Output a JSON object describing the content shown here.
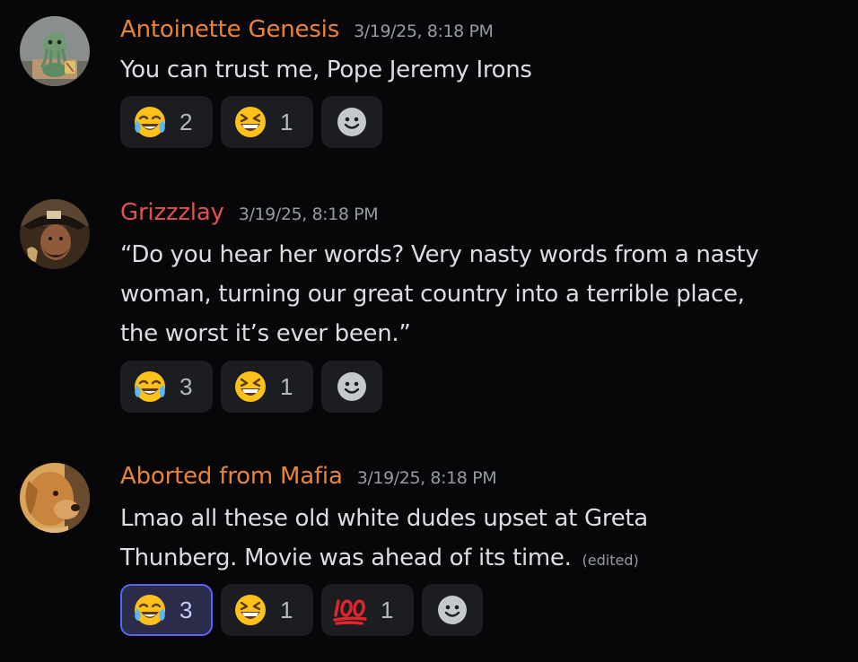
{
  "messages": [
    {
      "username": "Antoinette Genesis",
      "username_color": "#e8843a",
      "timestamp": "3/19/25, 8:18 PM",
      "avatar_icon": "cthulhu-avatar",
      "lines": [
        "You can trust me, Pope Jeremy Irons"
      ],
      "reactions": [
        {
          "emoji": "joy-emoji",
          "count": "2",
          "me": false
        },
        {
          "emoji": "laughing-emoji",
          "count": "1",
          "me": false
        }
      ]
    },
    {
      "username": "Grizzzlay",
      "username_color": "#e0504f",
      "timestamp": "3/19/25, 8:18 PM",
      "avatar_icon": "pirate-avatar",
      "lines": [
        "“Do you hear her words? Very nasty words from a nasty",
        "woman, turning our great country into a terrible place,",
        "the worst it’s ever been.”"
      ],
      "reactions": [
        {
          "emoji": "joy-emoji",
          "count": "3",
          "me": false
        },
        {
          "emoji": "laughing-emoji",
          "count": "1",
          "me": false
        }
      ]
    },
    {
      "username": "Aborted from Mafia",
      "username_color": "#e8843a",
      "timestamp": "3/19/25, 8:18 PM",
      "avatar_icon": "dog-avatar",
      "lines": [
        "Lmao all these old white dudes upset at Greta",
        "Thunberg. Movie was ahead of its time."
      ],
      "edited_label": "(edited)",
      "reactions": [
        {
          "emoji": "joy-emoji",
          "count": "3",
          "me": true
        },
        {
          "emoji": "laughing-emoji",
          "count": "1",
          "me": false
        },
        {
          "emoji": "hundred-emoji",
          "count": "1",
          "me": false
        }
      ]
    }
  ],
  "colors": {
    "background": "#070709",
    "reaction_bg": "#1c1d21",
    "reaction_me_border": "#5865f2",
    "timestamp": "#949ba4",
    "text": "#dbdee1"
  },
  "add_reaction_icon": "smiley-icon"
}
